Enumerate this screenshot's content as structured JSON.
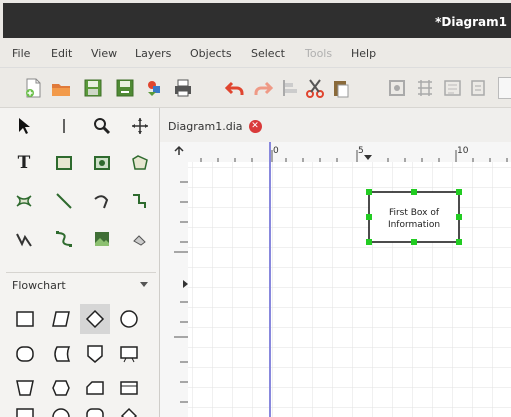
{
  "window": {
    "title": "*Diagram1"
  },
  "menu": [
    "File",
    "Edit",
    "View",
    "Layers",
    "Objects",
    "Select",
    "Tools",
    "Help"
  ],
  "menu_disabled": [
    "Tools"
  ],
  "tabs": [
    {
      "label": "Diagram1.dia",
      "modified": true
    }
  ],
  "toolbox": {
    "text_tool_label": "T"
  },
  "sheet": {
    "selected": "Flowchart"
  },
  "ruler": {
    "horizontal_labels": [
      "0",
      "5",
      "10"
    ]
  },
  "diagram": {
    "box_text": [
      "First Box of",
      "Information"
    ]
  },
  "colors": {
    "accent": "#e0452f",
    "handle": "#22cc22",
    "guide": "#8888dd",
    "titlebar": "#2f2f2f"
  }
}
